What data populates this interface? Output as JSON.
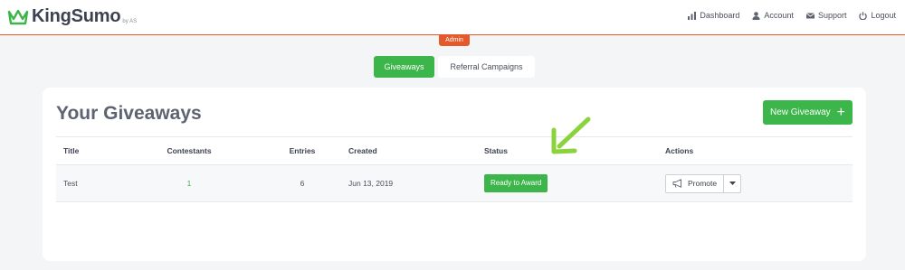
{
  "brand": {
    "name": "KingSumo",
    "sub": "by AS",
    "logo_icon": "crown-icon",
    "accent": "#3cb54a",
    "admin_color": "#e45a2a"
  },
  "topnav": [
    {
      "label": "Dashboard",
      "icon": "bar-chart-icon"
    },
    {
      "label": "Account",
      "icon": "user-icon"
    },
    {
      "label": "Support",
      "icon": "envelope-icon"
    },
    {
      "label": "Logout",
      "icon": "power-icon"
    }
  ],
  "admin_badge": "Admin",
  "tabs": [
    {
      "label": "Giveaways",
      "active": true
    },
    {
      "label": "Referral Campaigns",
      "active": false
    }
  ],
  "page": {
    "title": "Your Giveaways",
    "new_button": "New Giveaway"
  },
  "table": {
    "columns": [
      "Title",
      "Contestants",
      "Entries",
      "Created",
      "Status",
      "Actions"
    ],
    "rows": [
      {
        "title": "Test",
        "contestants": "1",
        "entries": "6",
        "created": "Jun 13, 2019",
        "status": "Ready to Award",
        "action": "Promote"
      }
    ]
  },
  "annotation": {
    "icon": "green-arrow-icon"
  }
}
